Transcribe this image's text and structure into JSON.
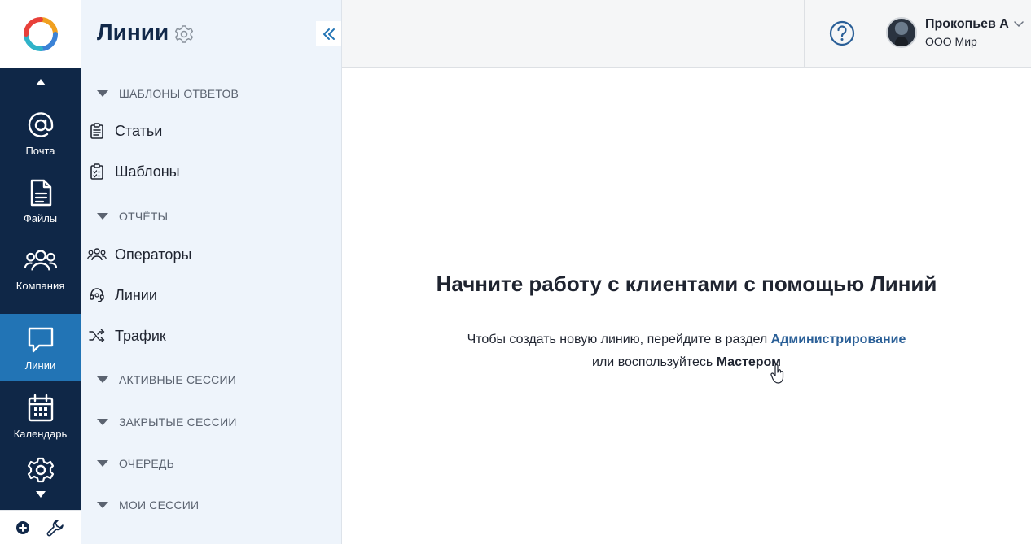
{
  "app_rail": {
    "items": [
      {
        "label": "Почта",
        "icon": "at-sign-icon"
      },
      {
        "label": "Файлы",
        "icon": "file-icon"
      },
      {
        "label": "Компания",
        "icon": "people-icon"
      },
      {
        "label": "Линии",
        "icon": "chat-bubble-icon",
        "active": true
      },
      {
        "label": "Календарь",
        "icon": "calendar-icon"
      },
      {
        "label": "",
        "icon": "gear-icon"
      }
    ]
  },
  "sidebar": {
    "title": "Линии",
    "sections": [
      {
        "label": "ШАБЛОНЫ ОТВЕТОВ"
      },
      {
        "label": "ОТЧЁТЫ"
      },
      {
        "label": "АКТИВНЫЕ СЕССИИ"
      },
      {
        "label": "ЗАКРЫТЫЕ СЕССИИ"
      },
      {
        "label": "ОЧЕРЕДЬ"
      },
      {
        "label": "МОИ СЕССИИ"
      }
    ],
    "items": [
      {
        "label": "Статьи",
        "icon": "clipboard-icon"
      },
      {
        "label": "Шаблоны",
        "icon": "checklist-icon"
      },
      {
        "label": "Операторы",
        "icon": "operators-icon"
      },
      {
        "label": "Линии",
        "icon": "headset-icon"
      },
      {
        "label": "Трафик",
        "icon": "shuffle-icon"
      }
    ]
  },
  "header": {
    "user": {
      "name": "Прокопьев А",
      "org": "ООО Мир"
    }
  },
  "main": {
    "title": "Начните работу с клиентами с помощью Линий",
    "text_part1": "Чтобы создать новую линию, перейдите в раздел ",
    "admin_link": "Администрирование",
    "text_part2": "или воспользуйтесь ",
    "wizard_link": "Мастером"
  },
  "colors": {
    "rail_bg": "#0f2747",
    "rail_active": "#2274b5",
    "sidebar_bg": "#eef4fb",
    "link": "#2a5f97"
  }
}
